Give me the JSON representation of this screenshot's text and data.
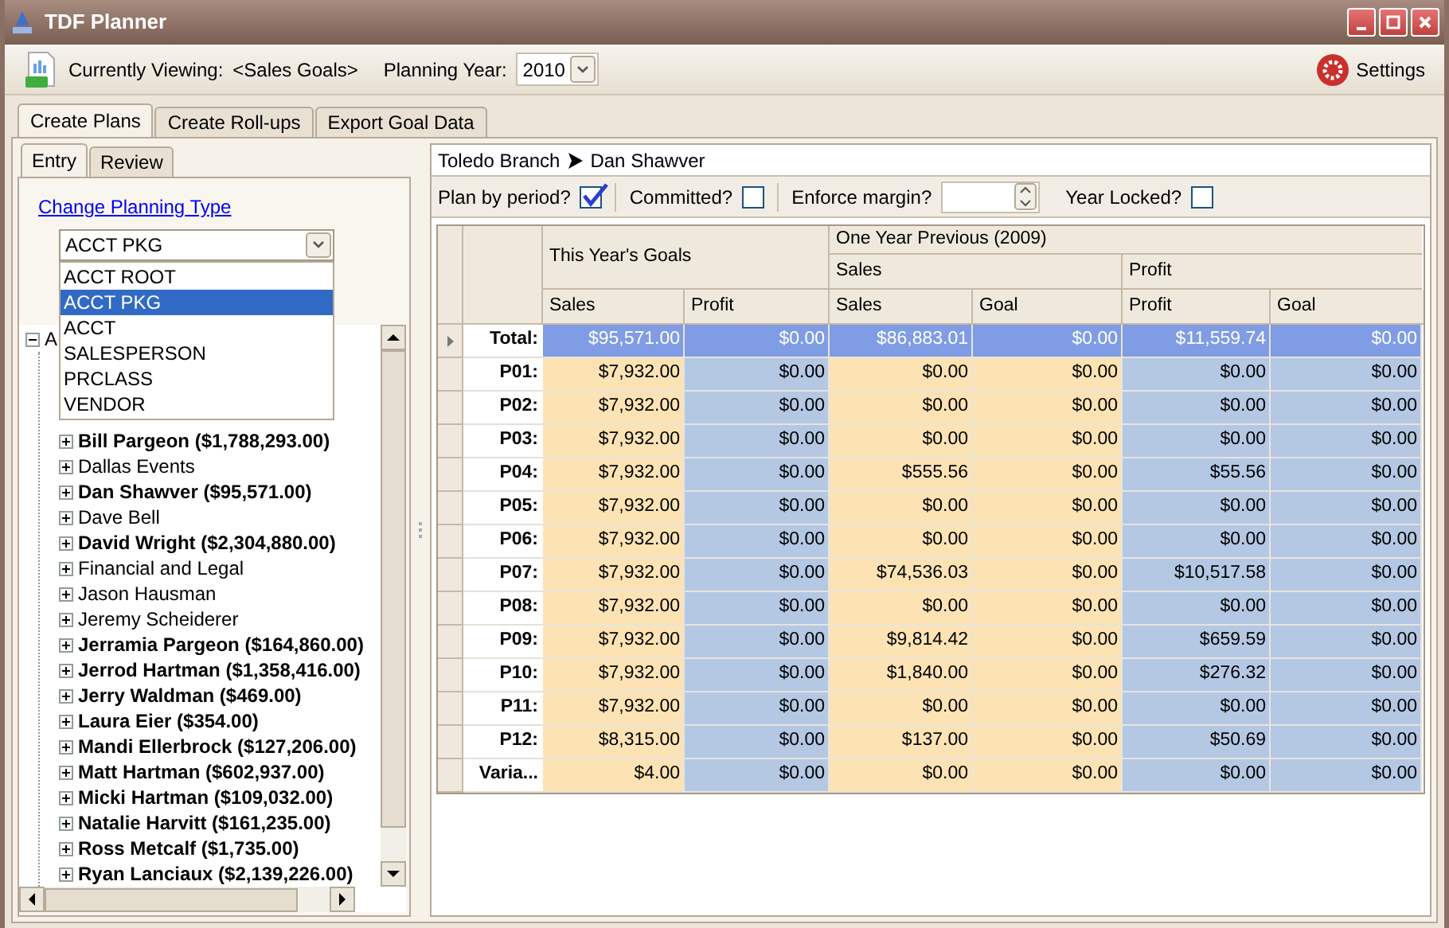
{
  "window": {
    "title": "TDF Planner"
  },
  "toolbar": {
    "viewing_label": "Currently Viewing:",
    "viewing_value": "<Sales Goals>",
    "year_label": "Planning Year:",
    "year_value": "2010",
    "settings": "Settings"
  },
  "main_tabs": [
    {
      "label": "Create Plans",
      "selected": true
    },
    {
      "label": "Create Roll-ups",
      "selected": false
    },
    {
      "label": "Export Goal Data",
      "selected": false
    }
  ],
  "sub_tabs": [
    {
      "label": "Entry",
      "selected": true
    },
    {
      "label": "Review",
      "selected": false
    }
  ],
  "change_link": "Change Planning Type",
  "planning_type": {
    "value": "ACCT PKG",
    "expanded": true,
    "options": [
      {
        "label": "ACCT ROOT",
        "selected": false
      },
      {
        "label": "ACCT PKG",
        "selected": true
      },
      {
        "label": "ACCT",
        "selected": false
      },
      {
        "label": "SALESPERSON",
        "selected": false
      },
      {
        "label": "PRCLASS",
        "selected": false
      },
      {
        "label": "VENDOR",
        "selected": false
      }
    ]
  },
  "tree": [
    {
      "label": "A",
      "expanded": true,
      "bold": false,
      "children": [
        {
          "label": "Bill Pargeon ($1,788,293.00)",
          "expanded": false,
          "bold": true
        },
        {
          "label": "Dallas Events",
          "expanded": false,
          "bold": false
        },
        {
          "label": "Dan Shawver ($95,571.00)",
          "expanded": false,
          "bold": true
        },
        {
          "label": "Dave Bell",
          "expanded": false,
          "bold": false
        },
        {
          "label": "David Wright ($2,304,880.00)",
          "expanded": false,
          "bold": true
        },
        {
          "label": "Financial and Legal",
          "expanded": false,
          "bold": false
        },
        {
          "label": "Jason Hausman",
          "expanded": false,
          "bold": false
        },
        {
          "label": "Jeremy Scheiderer",
          "expanded": false,
          "bold": false
        },
        {
          "label": "Jerramia Pargeon ($164,860.00)",
          "expanded": false,
          "bold": true
        },
        {
          "label": "Jerrod Hartman ($1,358,416.00)",
          "expanded": false,
          "bold": true
        },
        {
          "label": "Jerry Waldman ($469.00)",
          "expanded": false,
          "bold": true
        },
        {
          "label": "Laura Eier ($354.00)",
          "expanded": false,
          "bold": true
        },
        {
          "label": "Mandi Ellerbrock ($127,206.00)",
          "expanded": false,
          "bold": true
        },
        {
          "label": "Matt Hartman ($602,937.00)",
          "expanded": false,
          "bold": true
        },
        {
          "label": "Micki Hartman ($109,032.00)",
          "expanded": false,
          "bold": true
        },
        {
          "label": "Natalie Harvitt ($161,235.00)",
          "expanded": false,
          "bold": true
        },
        {
          "label": "Ross Metcalf ($1,735.00)",
          "expanded": false,
          "bold": true
        },
        {
          "label": "Ryan Lanciaux ($2,139,226.00)",
          "expanded": false,
          "bold": true
        }
      ]
    }
  ],
  "breadcrumb": [
    "Toledo Branch",
    "Dan Shawver"
  ],
  "options": [
    {
      "kind": "checkbox",
      "label": "Plan by period?",
      "checked": true
    },
    {
      "kind": "checkbox",
      "label": "Committed?",
      "checked": false
    },
    {
      "kind": "spinner",
      "label": "Enforce margin?"
    },
    {
      "kind": "checkbox",
      "label": "Year Locked?",
      "checked": false
    }
  ],
  "table": {
    "group_headers": {
      "this_year": "This Year's Goals",
      "previous": "One Year Previous (2009)",
      "prev_sales": "Sales",
      "prev_profit": "Profit"
    },
    "columns": [
      {
        "label": "Sales",
        "color": "#fde3b4"
      },
      {
        "label": "Profit",
        "color": "#b4c8e4"
      },
      {
        "label": "Sales",
        "color": "#fde3b4"
      },
      {
        "label": "Goal",
        "color": "#fde3b4"
      },
      {
        "label": "Profit",
        "color": "#b4c8e4"
      },
      {
        "label": "Goal",
        "color": "#b4c8e4"
      }
    ],
    "rows": [
      {
        "label": "Total:",
        "selected": true,
        "cells": [
          "$95,571.00",
          "$0.00",
          "$86,883.01",
          "$0.00",
          "$11,559.74",
          "$0.00"
        ]
      },
      {
        "label": "P01:",
        "selected": false,
        "cells": [
          "$7,932.00",
          "$0.00",
          "$0.00",
          "$0.00",
          "$0.00",
          "$0.00"
        ]
      },
      {
        "label": "P02:",
        "selected": false,
        "cells": [
          "$7,932.00",
          "$0.00",
          "$0.00",
          "$0.00",
          "$0.00",
          "$0.00"
        ]
      },
      {
        "label": "P03:",
        "selected": false,
        "cells": [
          "$7,932.00",
          "$0.00",
          "$0.00",
          "$0.00",
          "$0.00",
          "$0.00"
        ]
      },
      {
        "label": "P04:",
        "selected": false,
        "cells": [
          "$7,932.00",
          "$0.00",
          "$555.56",
          "$0.00",
          "$55.56",
          "$0.00"
        ]
      },
      {
        "label": "P05:",
        "selected": false,
        "cells": [
          "$7,932.00",
          "$0.00",
          "$0.00",
          "$0.00",
          "$0.00",
          "$0.00"
        ]
      },
      {
        "label": "P06:",
        "selected": false,
        "cells": [
          "$7,932.00",
          "$0.00",
          "$0.00",
          "$0.00",
          "$0.00",
          "$0.00"
        ]
      },
      {
        "label": "P07:",
        "selected": false,
        "cells": [
          "$7,932.00",
          "$0.00",
          "$74,536.03",
          "$0.00",
          "$10,517.58",
          "$0.00"
        ]
      },
      {
        "label": "P08:",
        "selected": false,
        "cells": [
          "$7,932.00",
          "$0.00",
          "$0.00",
          "$0.00",
          "$0.00",
          "$0.00"
        ]
      },
      {
        "label": "P09:",
        "selected": false,
        "cells": [
          "$7,932.00",
          "$0.00",
          "$9,814.42",
          "$0.00",
          "$659.59",
          "$0.00"
        ]
      },
      {
        "label": "P10:",
        "selected": false,
        "cells": [
          "$7,932.00",
          "$0.00",
          "$1,840.00",
          "$0.00",
          "$276.32",
          "$0.00"
        ]
      },
      {
        "label": "P11:",
        "selected": false,
        "cells": [
          "$7,932.00",
          "$0.00",
          "$0.00",
          "$0.00",
          "$0.00",
          "$0.00"
        ]
      },
      {
        "label": "P12:",
        "selected": false,
        "cells": [
          "$8,315.00",
          "$0.00",
          "$137.00",
          "$0.00",
          "$50.69",
          "$0.00"
        ]
      },
      {
        "label": "Varia...",
        "selected": false,
        "cells": [
          "$4.00",
          "$0.00",
          "$0.00",
          "$0.00",
          "$0.00",
          "$0.00"
        ]
      }
    ]
  }
}
